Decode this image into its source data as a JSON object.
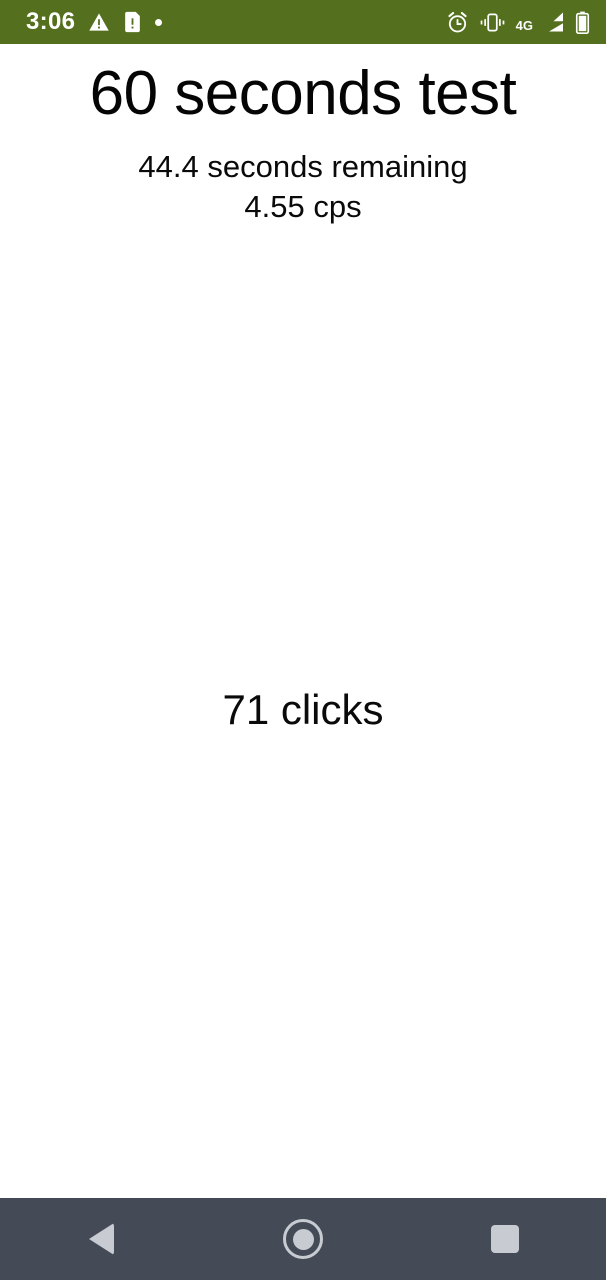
{
  "status_bar": {
    "background_color": "#54701f",
    "clock": "3:06",
    "left_icons": [
      {
        "name": "warning-triangle-icon",
        "glyph": "warning"
      },
      {
        "name": "sim-card-alert-icon",
        "glyph": "sim-alert"
      },
      {
        "name": "notification-dot-icon",
        "glyph": "dot"
      }
    ],
    "right_icons": [
      {
        "name": "alarm-clock-icon",
        "glyph": "alarm"
      },
      {
        "name": "vibrate-mode-icon",
        "glyph": "vibrate"
      },
      {
        "name": "signal-bars-icon",
        "glyph": "signal"
      },
      {
        "name": "battery-icon",
        "glyph": "battery"
      }
    ],
    "network_type": "4G"
  },
  "app": {
    "title": "60 seconds test",
    "time_remaining": "44.4 seconds remaining",
    "clicks_per_second": "4.55 cps",
    "click_count": "71 clicks",
    "background_color": "#ffffff",
    "text_color": "#0a0a0a"
  },
  "nav_bar": {
    "background_color": "#444b57",
    "icon_color": "#c8ccd2",
    "buttons": [
      {
        "name": "back-button",
        "label": "Back"
      },
      {
        "name": "home-button",
        "label": "Home"
      },
      {
        "name": "recents-button",
        "label": "Recent apps"
      }
    ]
  }
}
